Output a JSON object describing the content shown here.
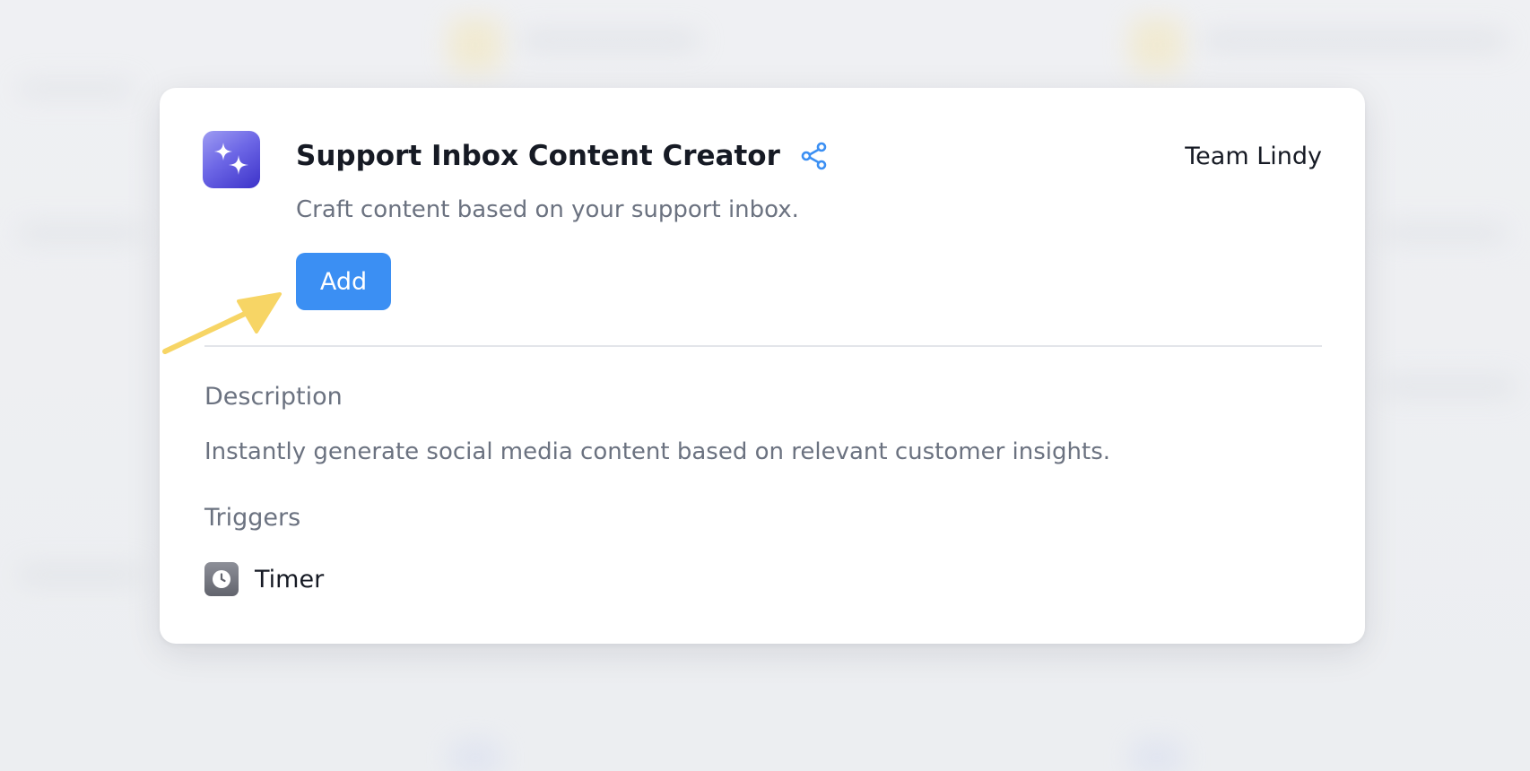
{
  "card": {
    "title": "Support Inbox Content Creator",
    "subtitle": "Craft content based on your support inbox.",
    "author": "Team Lindy",
    "add_label": "Add",
    "icon": "sparkles-icon",
    "share_icon": "share-icon"
  },
  "description": {
    "heading": "Description",
    "text": "Instantly generate social media content based on relevant customer insights."
  },
  "triggers": {
    "heading": "Triggers",
    "items": [
      {
        "label": "Timer",
        "icon": "clock-icon"
      }
    ]
  },
  "colors": {
    "accent": "#3b8ff3",
    "annotation_arrow": "#f7d565",
    "app_icon_gradient": [
      "#9e9cf2",
      "#3c32c9"
    ]
  }
}
